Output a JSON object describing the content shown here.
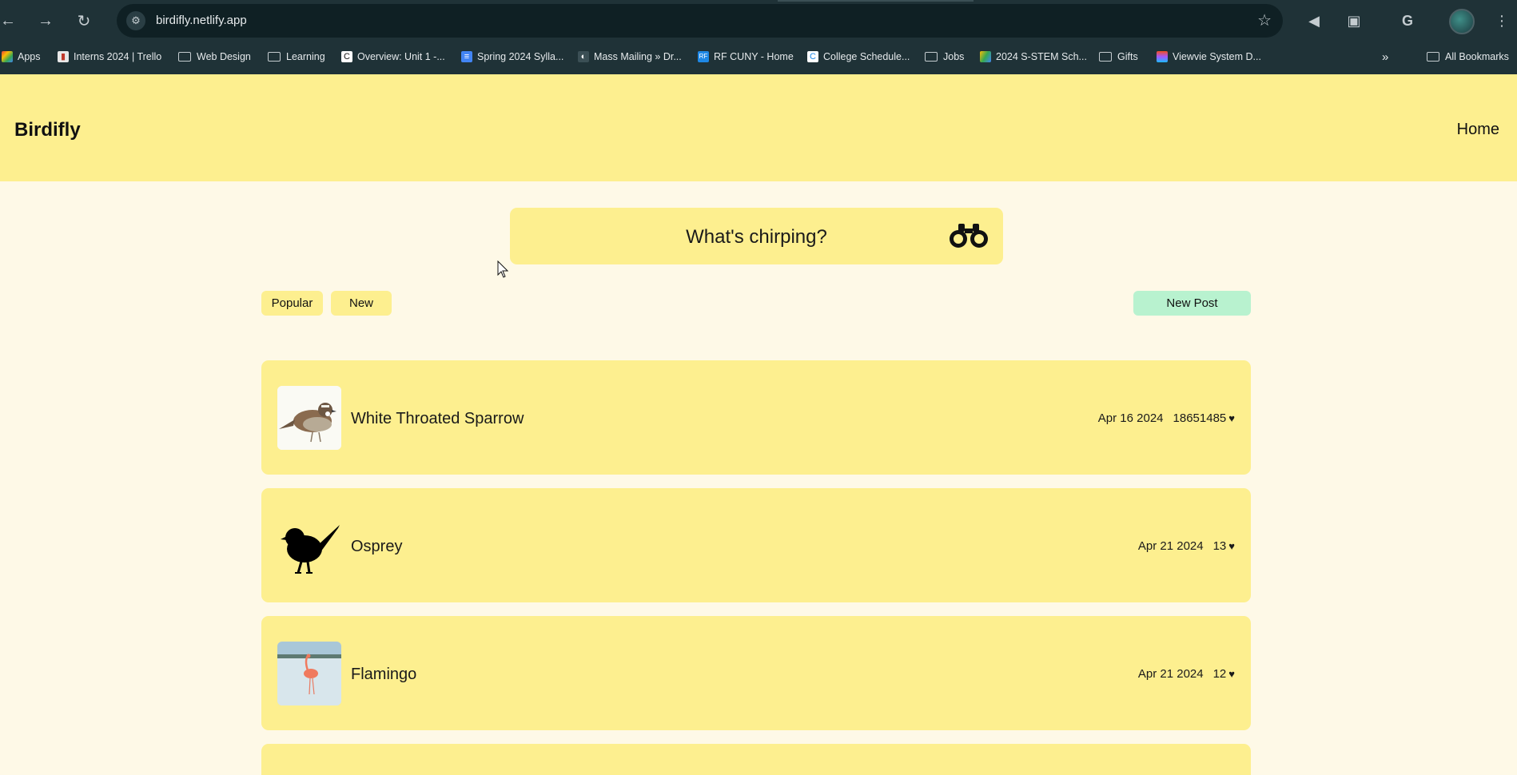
{
  "browser": {
    "url": "birdifly.netlify.app",
    "bookmarks": [
      {
        "label": "Apps",
        "icon": "apps-grid-icon"
      },
      {
        "label": "Interns 2024 | Trello",
        "icon": "trello-icon"
      },
      {
        "label": "Web Design",
        "icon": "folder-icon"
      },
      {
        "label": "Learning",
        "icon": "folder-icon"
      },
      {
        "label": "Overview: Unit 1 -...",
        "icon": "site-icon"
      },
      {
        "label": "Spring 2024 Sylla...",
        "icon": "docs-icon"
      },
      {
        "label": "Mass Mailing » Dr...",
        "icon": "site-icon"
      },
      {
        "label": "RF CUNY - Home",
        "icon": "rf-icon"
      },
      {
        "label": "College Schedule...",
        "icon": "site-icon"
      },
      {
        "label": "Jobs",
        "icon": "folder-icon"
      },
      {
        "label": "2024 S-STEM Sch...",
        "icon": "drive-icon"
      },
      {
        "label": "Gifts",
        "icon": "folder-icon"
      },
      {
        "label": "Viewvie System D...",
        "icon": "figma-icon"
      }
    ],
    "all_bookmarks": "All Bookmarks",
    "overflow": "»"
  },
  "site": {
    "brand": "Birdifly",
    "nav_home": "Home",
    "search_placeholder": "What's chirping?",
    "filters": {
      "popular": "Popular",
      "new": "New"
    },
    "new_post": "New Post"
  },
  "posts": [
    {
      "title": "White Throated Sparrow",
      "date": "Apr 16 2024",
      "likes": "18651485",
      "heart": "♥",
      "thumb": "sparrow-photo"
    },
    {
      "title": "Osprey",
      "date": "Apr 21 2024",
      "likes": "13",
      "heart": "♥",
      "thumb": "bird-silhouette"
    },
    {
      "title": "Flamingo",
      "date": "Apr 21 2024",
      "likes": "12",
      "heart": "♥",
      "thumb": "flamingo-photo"
    }
  ],
  "colors": {
    "header_bg": "#fdef8f",
    "page_bg": "#fef9e7",
    "new_post_bg": "#b8f2cf",
    "chrome_bg": "#1f3237"
  }
}
